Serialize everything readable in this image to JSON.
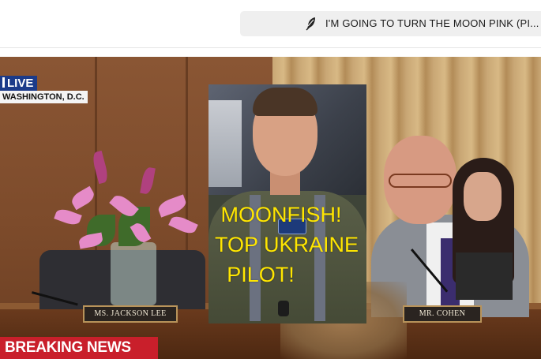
{
  "header": {
    "post_title": "I'M GOING TO TURN THE MOON PINK (PI...",
    "post_icon": "feather-pen-icon"
  },
  "video": {
    "live_label": "LIVE",
    "location": "WASHINGTON, D.C.",
    "breaking_label": "BREAKING NEWS",
    "nameplate_left": "MS. JACKSON LEE",
    "nameplate_right": "MR. COHEN",
    "overlay_lines": [
      "MOONFISH!",
      "TOP UKRAINE",
      "PILOT!"
    ],
    "overlay_color": "#ffe600",
    "breaking_color": "#c91f2b",
    "live_color": "#1b3b8a"
  }
}
